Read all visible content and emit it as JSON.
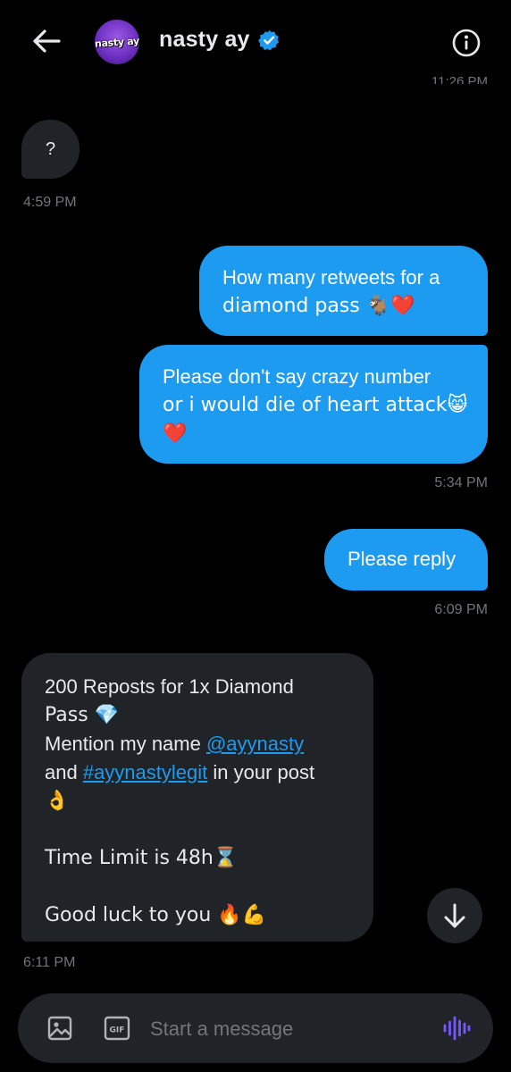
{
  "header": {
    "title": "nasty ay",
    "avatar_text": "nasty ay",
    "cutoff_time": "11:26 PM",
    "icons": {
      "back": "arrow-left-icon",
      "verified": "verified-badge-icon",
      "info": "info-icon"
    },
    "verified_color": "#1d9bf0"
  },
  "messages": [
    {
      "direction": "in",
      "text": "?",
      "time": "4:59 PM"
    },
    {
      "direction": "out",
      "text_line1": "How many retweets for a",
      "text_line2": "diamond pass 🐐❤️"
    },
    {
      "direction": "out",
      "text_line1": "Please don't say crazy number",
      "text_line2": "or i would die of heart attack😸",
      "text_line3": "❤️",
      "time": "5:34 PM"
    },
    {
      "direction": "out",
      "text": "Please reply",
      "time": "6:09 PM"
    },
    {
      "direction": "in",
      "line1": "200 Reposts for 1x Diamond",
      "line2": "Pass 💎",
      "line3_prefix": "Mention my name ",
      "mention": "@ayynasty",
      "line4_prefix": "and ",
      "hashtag": "#ayynastylegit",
      "line4_suffix": " in your post",
      "line5": "👌",
      "line6": "Time Limit is 48h⌛",
      "line7": "Good luck to you 🔥💪",
      "time": "6:11 PM"
    }
  ],
  "scroll_down": {
    "icon": "arrow-down-icon"
  },
  "composer": {
    "placeholder": "Start a message",
    "gif_label": "GIF",
    "icons": {
      "image": "image-icon",
      "gif": "gif-icon",
      "voice": "voice-icon"
    }
  },
  "colors": {
    "background": "#000000",
    "incoming_bubble": "#202327",
    "outgoing_bubble": "#1d9bf0",
    "link": "#1d9bf0",
    "muted": "#71767b",
    "voice_icon": "#7856ff"
  }
}
